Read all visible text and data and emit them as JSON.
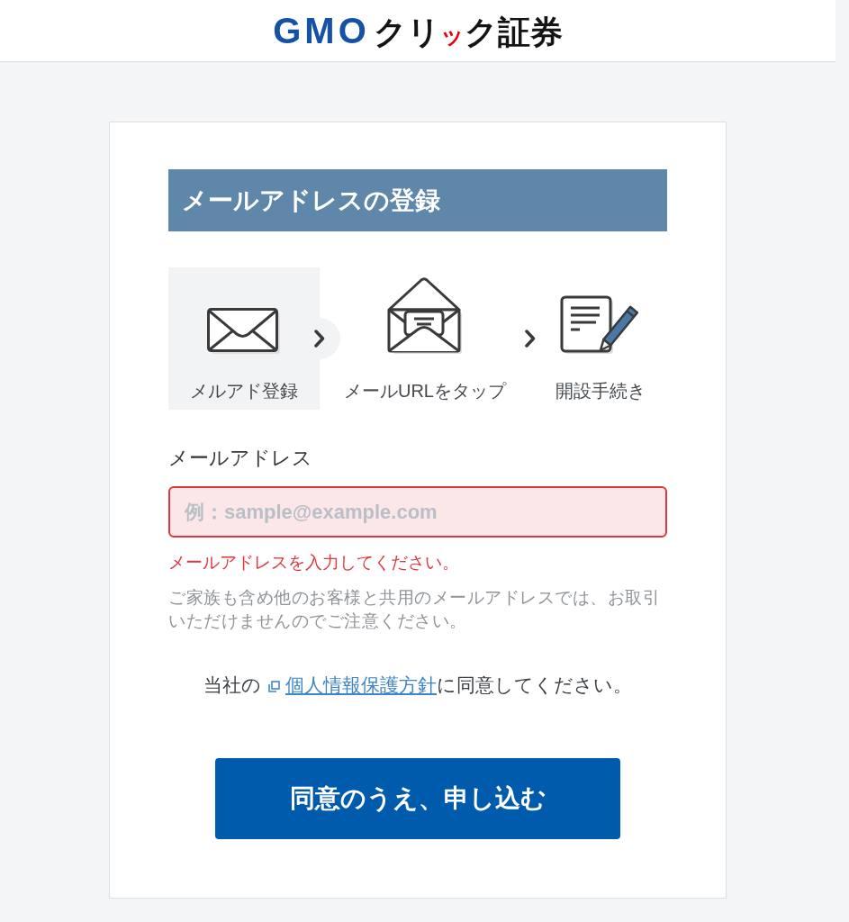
{
  "header": {
    "logo": [
      {
        "text": "GMO",
        "kind": "brand"
      },
      {
        "text": "クリ",
        "kind": "name"
      },
      {
        "text": "ッ",
        "kind": "accent"
      },
      {
        "text": "ク証券",
        "kind": "name"
      }
    ]
  },
  "form": {
    "title": "メールアドレスの登録",
    "steps": [
      {
        "label": "メルアド登録",
        "kind": "envelope",
        "selected": true
      },
      {
        "label": "メールURLをタップ",
        "kind": "open-envelope",
        "selected": false
      },
      {
        "label": "開設手続き",
        "kind": "document",
        "selected": false
      }
    ],
    "email_field": {
      "label": "メールアドレス",
      "placeholder": "例：sample@example.com",
      "invalid": true,
      "error_message": "メールアドレスを入力してください。",
      "note": "ご家族も含め他のお客様と共用のメールアドレスでは、お取引いただけませんのでご注意ください。"
    },
    "consent": {
      "before": "当社の",
      "link": "個人情報保護方針",
      "after": "に同意してください。"
    },
    "submit_button": "同意のうえ、申し込む"
  }
}
